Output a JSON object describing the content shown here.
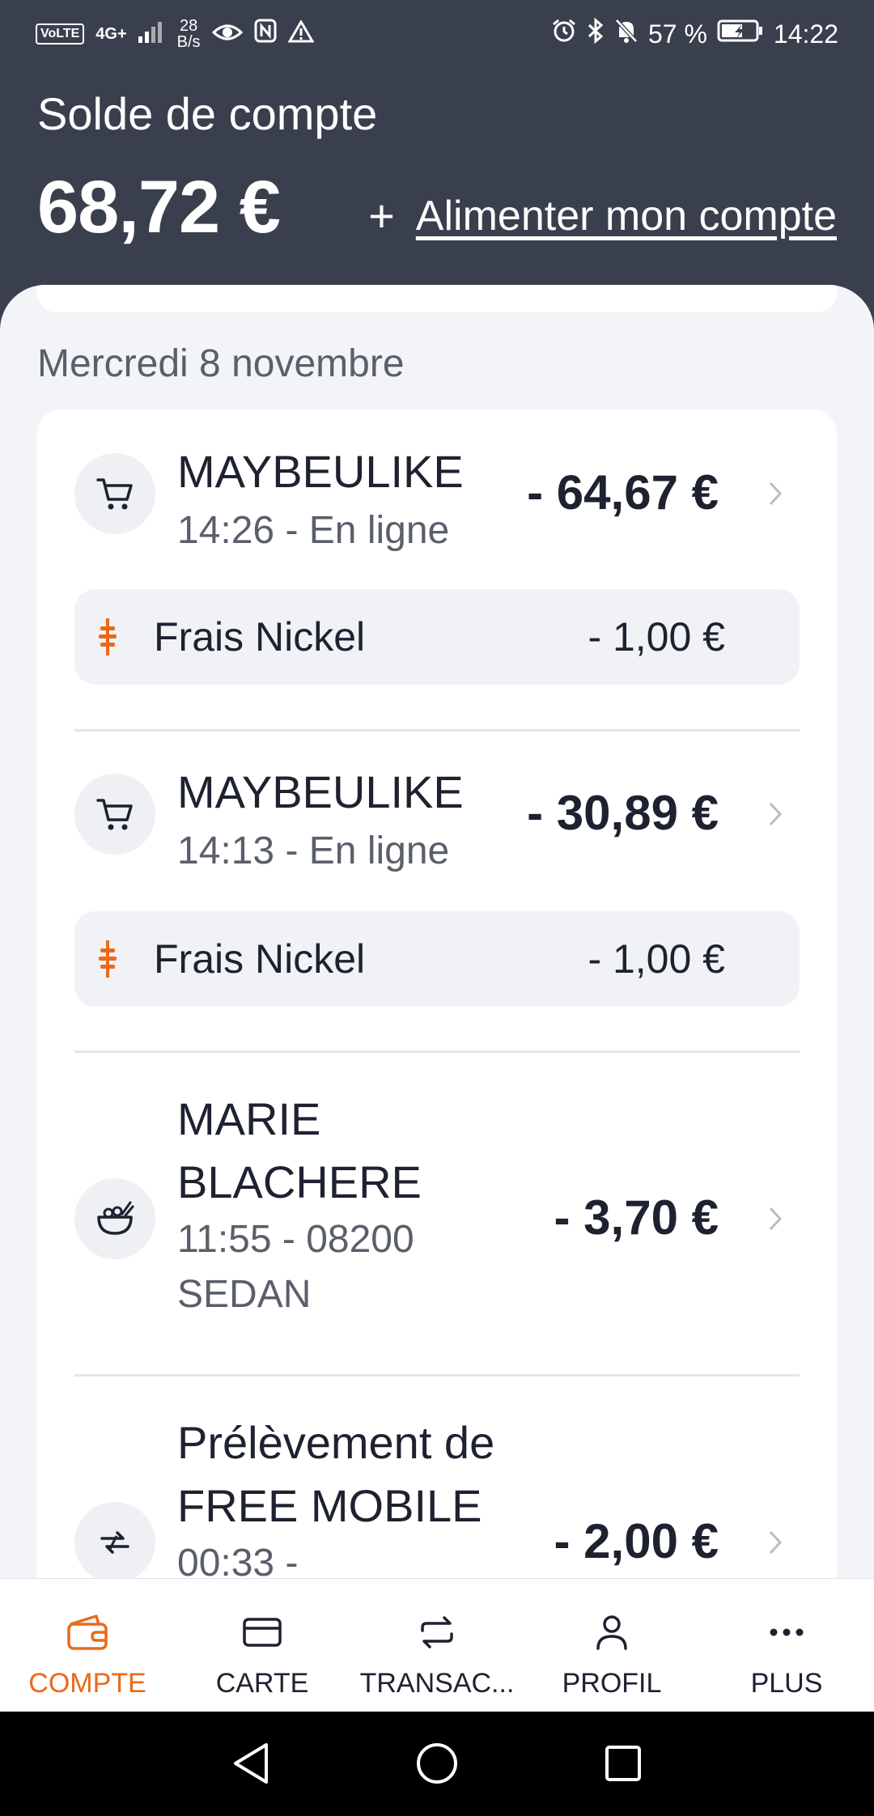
{
  "status_bar": {
    "network_badge": "VoLTE",
    "network_type": "4G+",
    "data_rate_value": "28",
    "data_rate_unit": "B/s",
    "battery": "57 %",
    "time": "14:22",
    "icons": [
      "eye-icon",
      "nfc-icon",
      "warning-icon",
      "alarm-icon",
      "bluetooth-icon",
      "mute-icon",
      "battery-icon"
    ]
  },
  "header": {
    "title": "Solde de compte",
    "balance": "68,72 €",
    "topup_plus": "+",
    "topup_label": "Alimenter mon compte"
  },
  "day": {
    "date": "Mercredi 8 novembre"
  },
  "transactions": [
    {
      "icon": "cart-icon",
      "name": "MAYBEULIKE",
      "sub": "14:26 - En ligne",
      "amount": "- 64,67 €",
      "fee": {
        "icon": "nickel-icon",
        "label": "Frais Nickel",
        "amount": "- 1,00 €"
      }
    },
    {
      "icon": "cart-icon",
      "name": "MAYBEULIKE",
      "sub": "14:13 - En ligne",
      "amount": "- 30,89 €",
      "fee": {
        "icon": "nickel-icon",
        "label": "Frais Nickel",
        "amount": "- 1,00 €"
      }
    },
    {
      "icon": "food-bowl-icon",
      "name": "MARIE BLACHERE",
      "sub": "11:55 - 08200 SEDAN",
      "amount": "- 3,70 €"
    },
    {
      "icon": "transfer-icon",
      "name": "Prélèvement de FREE MOBILE",
      "sub": "00:33 -",
      "amount": "- 2,00 €"
    }
  ],
  "bottom_nav": [
    {
      "label": "COMPTE",
      "icon": "wallet-icon",
      "active": true
    },
    {
      "label": "CARTE",
      "icon": "card-icon",
      "active": false
    },
    {
      "label": "TRANSAC...",
      "icon": "exchange-icon",
      "active": false
    },
    {
      "label": "PROFIL",
      "icon": "person-icon",
      "active": false
    },
    {
      "label": "PLUS",
      "icon": "more-icon",
      "active": false
    }
  ],
  "colors": {
    "header_bg": "#3a3f4e",
    "accent": "#ea6a1b",
    "content_bg": "#f3f4f7"
  }
}
